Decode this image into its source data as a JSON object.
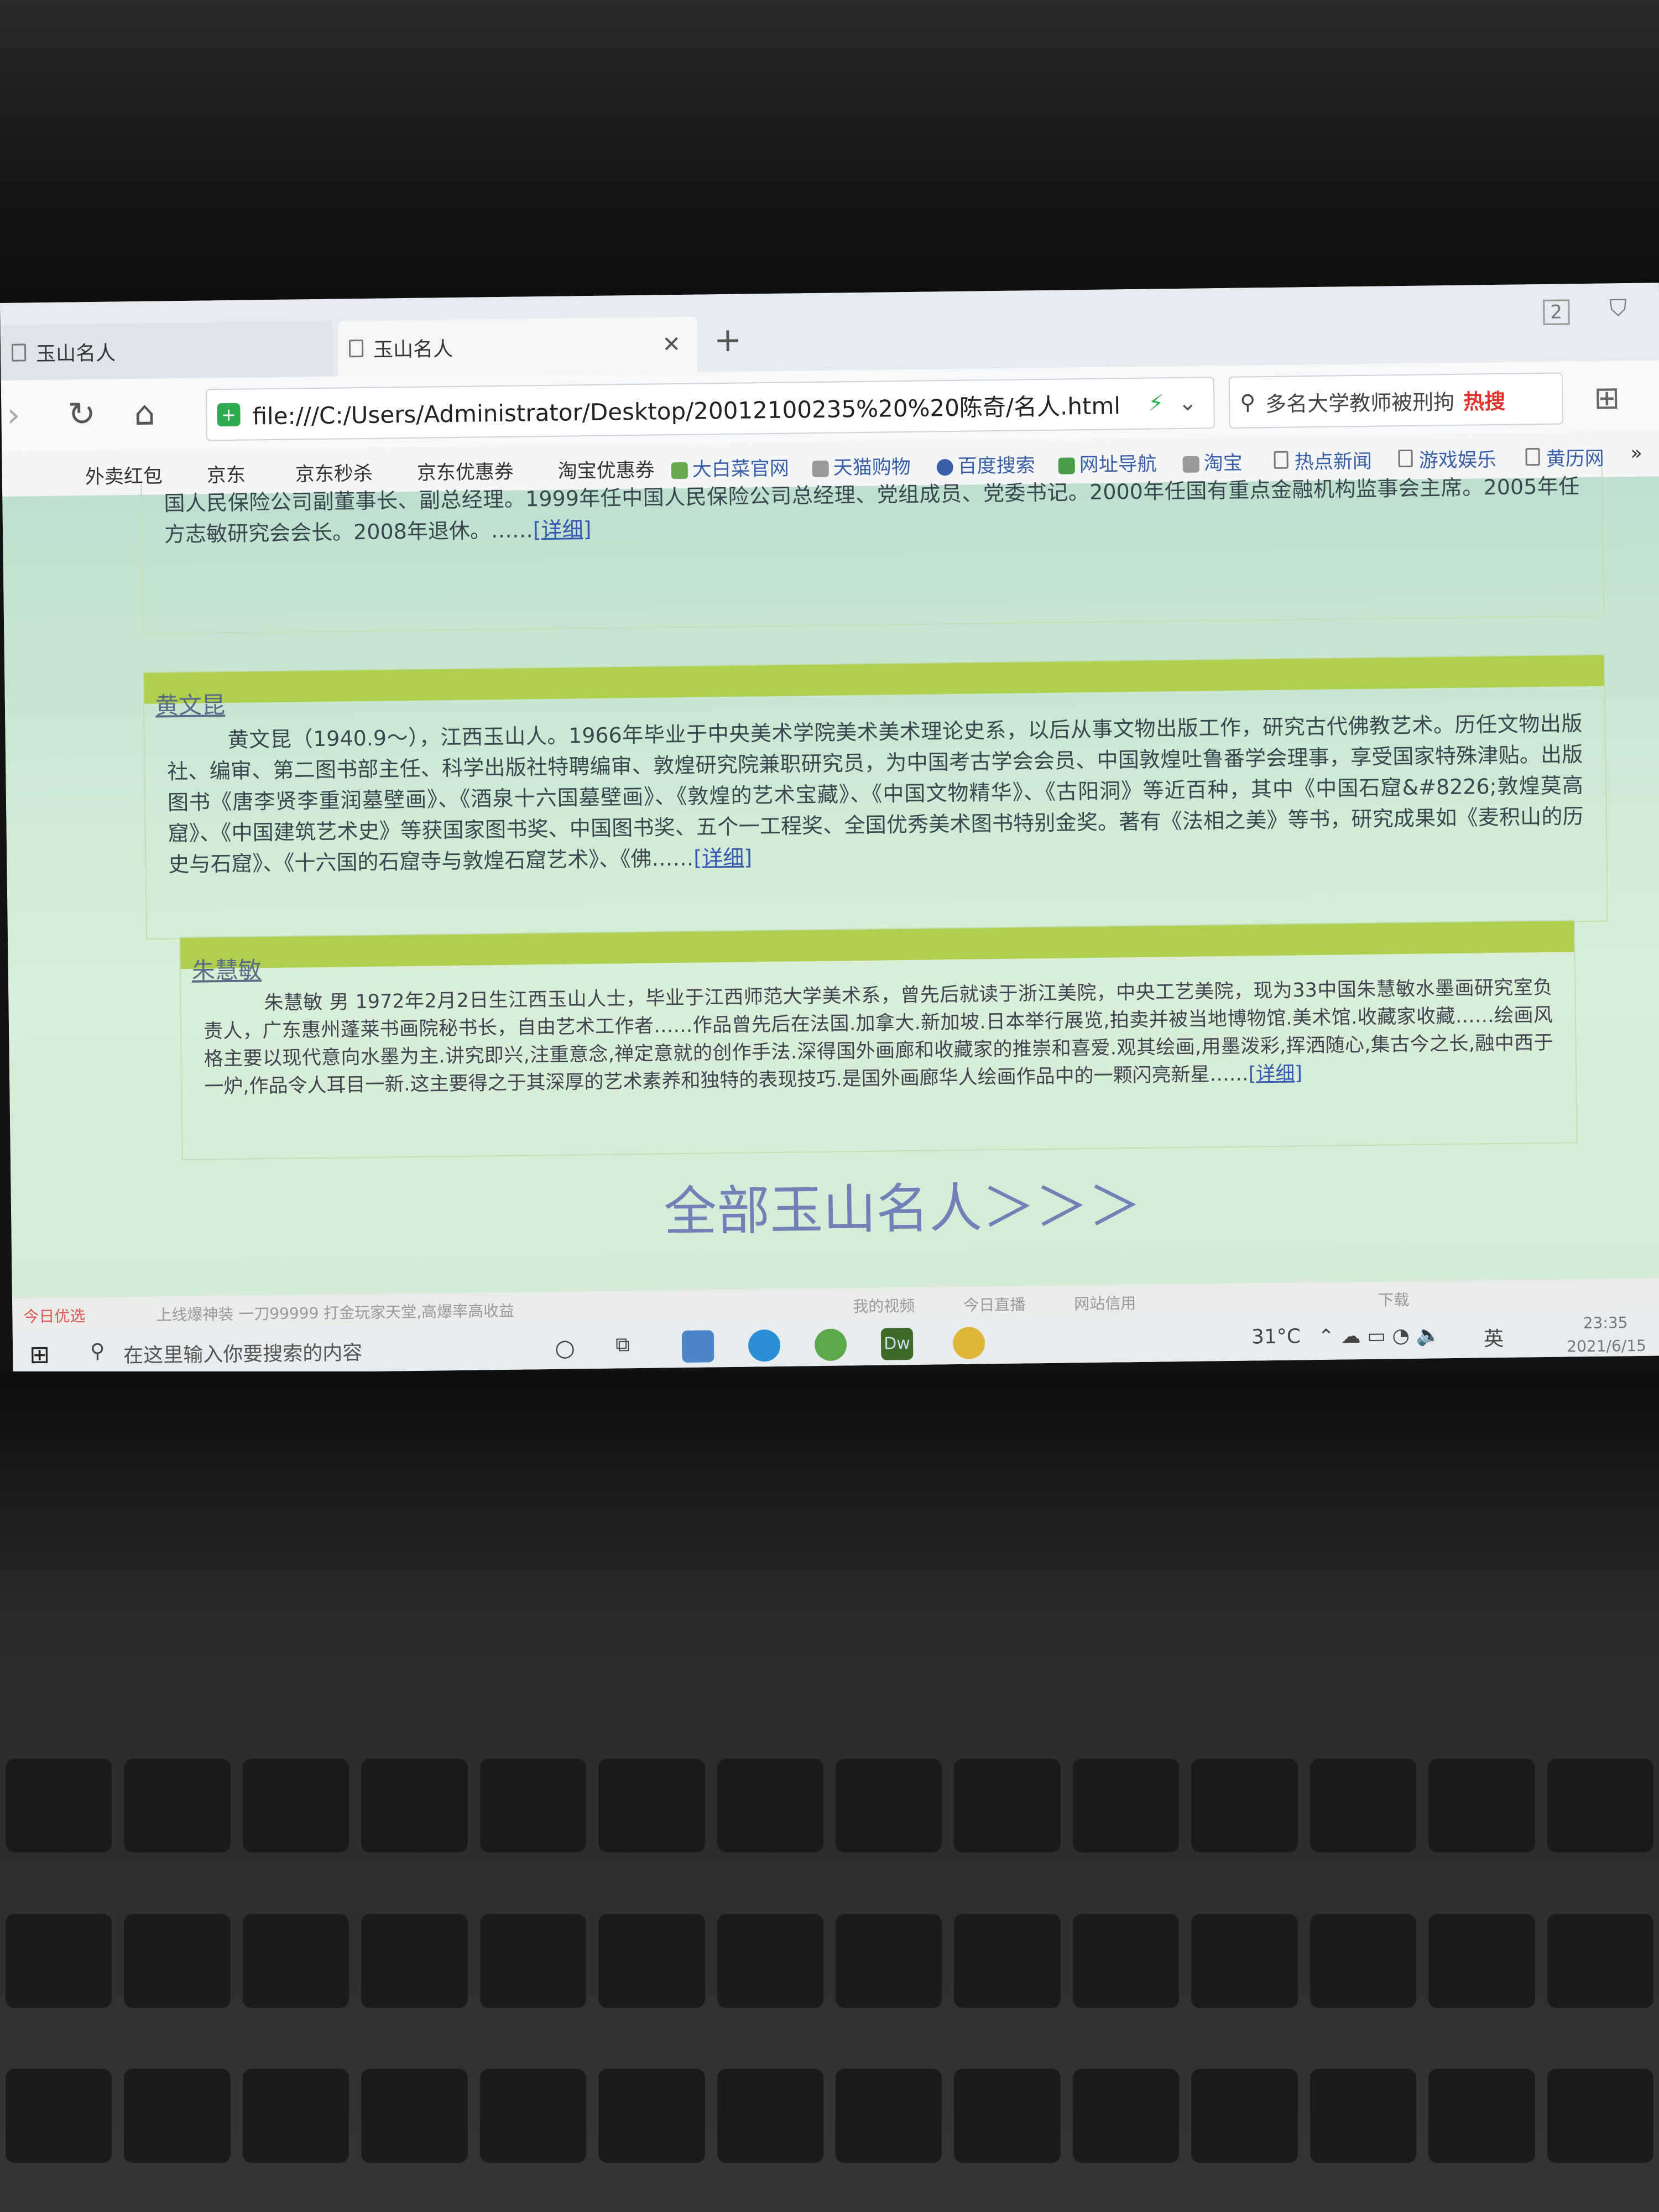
{
  "tabs": [
    {
      "label": "玉山名人",
      "active": false
    },
    {
      "label": "玉山名人",
      "active": true
    }
  ],
  "window_badge": "2",
  "address": {
    "url": "file:///C:/Users/Administrator/Desktop/20012100235%20%20陈奇/名人.html"
  },
  "search": {
    "text": "多名大学教师被刑拘",
    "hot_label": "热搜"
  },
  "bookmarks": [
    "外卖红包",
    "京东",
    "京东秒杀",
    "京东优惠券",
    "淘宝优惠券",
    "大白菜官网",
    "天猫购物",
    "百度搜索",
    "网址导航",
    "淘宝",
    "热点新闻",
    "游戏娱乐",
    "黄历网"
  ],
  "entries": [
    {
      "name": "",
      "text": "国人民保险公司副董事长、副总经理。1999年任中国人民保险公司总经理、党组成员、党委书记。2000年任国有重点金融机构监事会主席。2005年任方志敏研究会会长。2008年退休。……",
      "more": "[详细]"
    },
    {
      "name": "黄文昆",
      "text": "黄文昆（1940.9～），江西玉山人。1966年毕业于中央美术学院美术美术理论史系，以后从事文物出版工作，研究古代佛教艺术。历任文物出版社、编审、第二图书部主任、科学出版社特聘编审、敦煌研究院兼职研究员，为中国考古学会会员、中国敦煌吐鲁番学会理事，享受国家特殊津贴。出版图书《唐李贤李重润墓壁画》、《酒泉十六国墓壁画》、《敦煌的艺术宝藏》、《中国文物精华》、《古阳洞》等近百种，其中《中国石窟&#8226;敦煌莫高窟》、《中国建筑艺术史》等获国家图书奖、中国图书奖、五个一工程奖、全国优秀美术图书特别金奖。著有《法相之美》等书，研究成果如《麦积山的历史与石窟》、《十六国的石窟寺与敦煌石窟艺术》、《佛……",
      "more": "[详细]"
    },
    {
      "name": "朱慧敏",
      "text": "朱慧敏 男 1972年2月2日生江西玉山人士，毕业于江西师范大学美术系，曾先后就读于浙江美院，中央工艺美院，现为33中国朱慧敏水墨画研究室负责人，广东惠州蓬莱书画院秘书长，自由艺术工作者……作品曾先后在法国.加拿大.新加坡.日本举行展览,拍卖并被当地博物馆.美术馆.收藏家收藏……绘画风格主要以现代意向水墨为主.讲究即兴,注重意念,禅定意就的创作手法.深得国外画廊和收藏家的推崇和喜爱.观其绘画,用墨泼彩,挥洒随心,集古今之长,融中西于一炉,作品令人耳目一新.这主要得之于其深厚的艺术素养和独特的表现技巧.是国外画廊华人绘画作品中的一颗闪亮新星……",
      "more": "[详细]"
    }
  ],
  "all_link": "全部玉山名人＞＞＞",
  "statusbar": {
    "left": "今日优选",
    "ticker": "上线爆神装 一刀99999 打金玩家天堂,高爆率高收益",
    "video": "我的视频",
    "live": "今日直播",
    "credit": "网站信用",
    "download": "下载"
  },
  "taskbar": {
    "search_placeholder": "在这里输入你要搜索的内容",
    "weather": "31°C",
    "ime": "英",
    "time": "23:35",
    "date": "2021/6/15"
  },
  "colors": {
    "section_bar": "#aed04e",
    "page_bg": "#d3e7da",
    "link": "#3459b3"
  }
}
